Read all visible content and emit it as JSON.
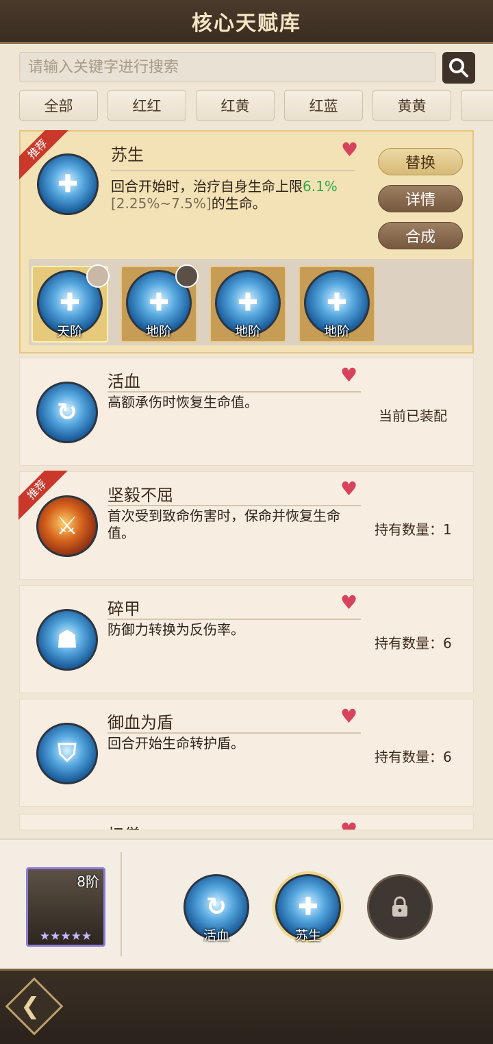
{
  "header": {
    "title": "核心天赋库"
  },
  "search": {
    "placeholder": "请输入关键字进行搜索"
  },
  "tabs": [
    {
      "label": "全部"
    },
    {
      "label": "红红"
    },
    {
      "label": "红黄"
    },
    {
      "label": "红蓝"
    },
    {
      "label": "黄黄"
    }
  ],
  "recommend_label": "推荐",
  "selected_talent": {
    "name": "苏生",
    "desc_prefix": "回合开始时，治疗自身生命上限",
    "desc_value": "6.1%",
    "desc_range": "[2.25%~7.5%]",
    "desc_suffix": "的生命。",
    "value_color": "#2fa84a",
    "range_color": "#7a6a58",
    "actions": {
      "replace": "替换",
      "details": "详情",
      "compose": "合成"
    },
    "variants": [
      {
        "label": "天阶"
      },
      {
        "label": "地阶"
      },
      {
        "label": "地阶"
      },
      {
        "label": "地阶"
      }
    ]
  },
  "talents": [
    {
      "name": "活血",
      "desc": "高额承伤时恢复生命值。",
      "status": "当前已装配"
    },
    {
      "name": "坚毅不屈",
      "desc": "首次受到致命伤害时，保命并恢复生命值。",
      "status": "持有数量：1"
    },
    {
      "name": "碎甲",
      "desc": "防御力转换为反伤率。",
      "status": "持有数量：6"
    },
    {
      "name": "御血为盾",
      "desc": "回合开始生命转护盾。",
      "status": "持有数量：6"
    },
    {
      "name": "扫僧"
    }
  ],
  "loadout": {
    "hero_rank": "8阶",
    "hero_stars": "★★★★★",
    "slots": [
      {
        "label": "活血"
      },
      {
        "label": "苏生"
      }
    ]
  }
}
